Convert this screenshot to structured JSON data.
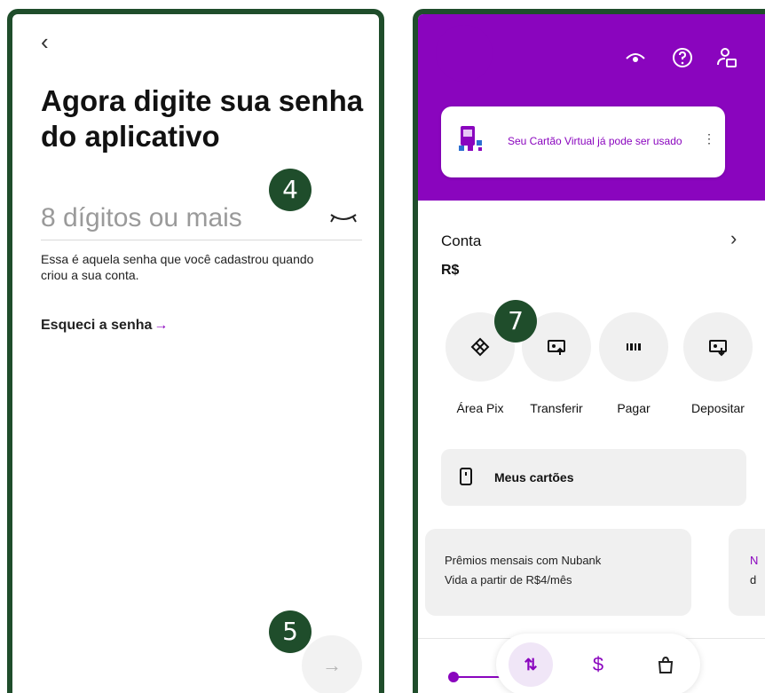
{
  "left_screen": {
    "back_glyph": "‹",
    "title": "Agora digite sua senha do aplicativo",
    "password_placeholder": "8 dígitos ou mais",
    "helper_text": "Essa é aquela senha que você cadastrou quando criou a sua conta.",
    "forgot_label": "Esqueci a senha",
    "forgot_arrow": "→",
    "next_arrow": "→",
    "badge_input": "4",
    "badge_next": "5"
  },
  "right_screen": {
    "banner_text": "Seu Cartão Virtual já pode ser usado",
    "banner_menu": "⋮",
    "account_label": "Conta",
    "account_balance": "R$",
    "account_chevron": "›",
    "badge_pix": "7",
    "actions": [
      {
        "label": "Área Pix",
        "icon": "pix-icon"
      },
      {
        "label": "Transferir",
        "icon": "transfer-icon"
      },
      {
        "label": "Pagar",
        "icon": "barcode-icon"
      },
      {
        "label": "Depositar",
        "icon": "deposit-icon"
      }
    ],
    "cards_label": "Meus cartões",
    "promos": [
      {
        "line1": "Prêmios mensais com Nubank",
        "line2": "Vida a partir de R$4/mês"
      },
      {
        "line1": "N",
        "line2": "d"
      }
    ],
    "nav": {
      "transfer": "⇅",
      "money": "$",
      "shop_icon": "shopping-bag-icon"
    }
  },
  "colors": {
    "accent": "#8a05be",
    "frame": "#1f4d2b",
    "surface": "#f0f0f0"
  }
}
